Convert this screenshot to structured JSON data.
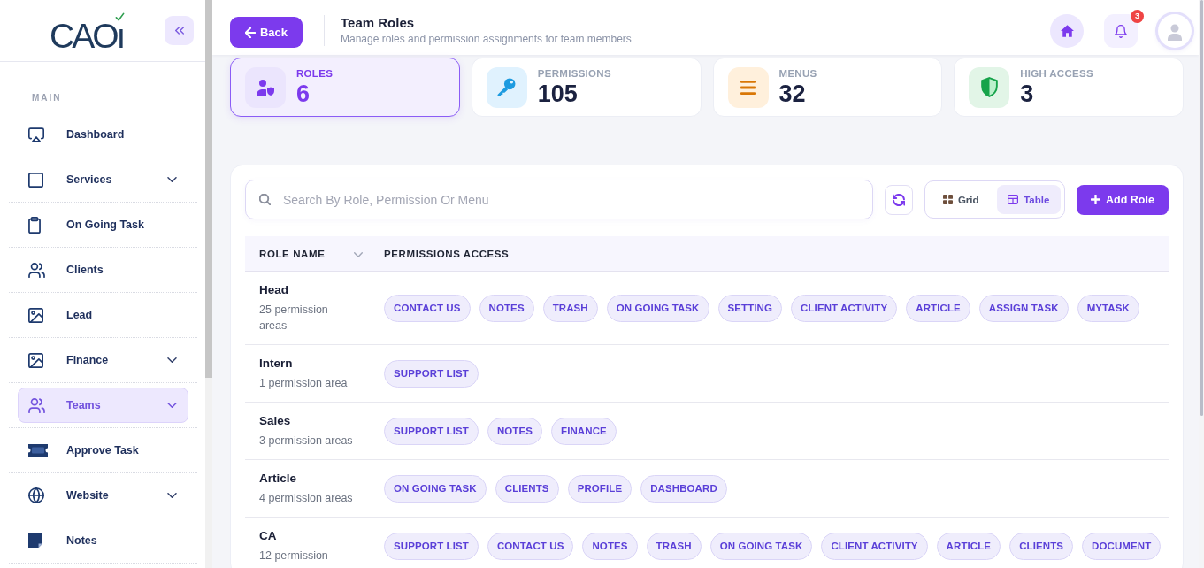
{
  "sidebar": {
    "logo": "CAOı",
    "section_label": "MAIN",
    "items": [
      {
        "label": "Dashboard",
        "expandable": false,
        "selected": false
      },
      {
        "label": "Services",
        "expandable": true,
        "selected": false
      },
      {
        "label": "On Going Task",
        "expandable": false,
        "selected": false
      },
      {
        "label": "Clients",
        "expandable": false,
        "selected": false
      },
      {
        "label": "Lead",
        "expandable": false,
        "selected": false
      },
      {
        "label": "Finance",
        "expandable": true,
        "selected": false
      },
      {
        "label": "Teams",
        "expandable": true,
        "selected": true
      },
      {
        "label": "Approve Task",
        "expandable": false,
        "selected": false
      },
      {
        "label": "Website",
        "expandable": true,
        "selected": false
      },
      {
        "label": "Notes",
        "expandable": false,
        "selected": false
      }
    ]
  },
  "header": {
    "back_button": "Back",
    "title": "Team Roles",
    "subtitle": "Manage roles and permission assignments for team members",
    "notification_count": "3"
  },
  "stats": [
    {
      "label": "ROLES",
      "value": "6",
      "selected": true
    },
    {
      "label": "PERMISSIONS",
      "value": "105",
      "selected": false
    },
    {
      "label": "MENUS",
      "value": "32",
      "selected": false
    },
    {
      "label": "HIGH ACCESS",
      "value": "3",
      "selected": false
    }
  ],
  "toolbar": {
    "search": {
      "placeholder": "Search By Role, Permission Or Menu"
    },
    "view_modes": [
      {
        "label": "Grid",
        "selected": false
      },
      {
        "label": "Table",
        "selected": true
      }
    ],
    "add_button": "Add Role"
  },
  "table": {
    "columns": [
      "ROLE NAME",
      "PERMISSIONS ACCESS"
    ],
    "rows": [
      {
        "name": "Head",
        "summary": "25 permission areas",
        "permissions": [
          "CONTACT US",
          "NOTES",
          "TRASH",
          "ON GOING TASK",
          "SETTING",
          "CLIENT ACTIVITY",
          "ARTICLE",
          "ASSIGN TASK",
          "MYTASK"
        ]
      },
      {
        "name": "Intern",
        "summary": "1 permission area",
        "permissions": [
          "SUPPORT LIST"
        ]
      },
      {
        "name": "Sales",
        "summary": "3 permission areas",
        "permissions": [
          "SUPPORT LIST",
          "NOTES",
          "FINANCE"
        ]
      },
      {
        "name": "Article",
        "summary": "4 permission areas",
        "permissions": [
          "ON GOING TASK",
          "CLIENTS",
          "PROFILE",
          "DASHBOARD"
        ]
      },
      {
        "name": "CA",
        "summary": "12 permission",
        "permissions": [
          "SUPPORT LIST",
          "CONTACT US",
          "NOTES",
          "TRASH",
          "ON GOING TASK",
          "CLIENT ACTIVITY",
          "ARTICLE",
          "CLIENTS",
          "DOCUMENT"
        ]
      }
    ]
  }
}
